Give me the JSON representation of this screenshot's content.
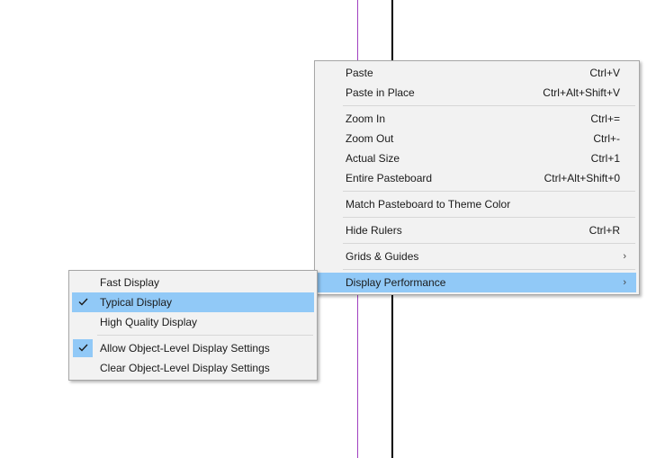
{
  "main_menu": {
    "items": [
      {
        "label": "Paste",
        "shortcut": "Ctrl+V"
      },
      {
        "label": "Paste in Place",
        "shortcut": "Ctrl+Alt+Shift+V"
      },
      {
        "label": "Zoom In",
        "shortcut": "Ctrl+="
      },
      {
        "label": "Zoom Out",
        "shortcut": "Ctrl+-"
      },
      {
        "label": "Actual Size",
        "shortcut": "Ctrl+1"
      },
      {
        "label": "Entire Pasteboard",
        "shortcut": "Ctrl+Alt+Shift+0"
      },
      {
        "label": "Match Pasteboard to Theme Color"
      },
      {
        "label": "Hide Rulers",
        "shortcut": "Ctrl+R"
      },
      {
        "label": "Grids & Guides",
        "arrow": "›"
      },
      {
        "label": "Display Performance",
        "arrow": "›",
        "highlighted": true
      }
    ]
  },
  "sub_menu": {
    "items": [
      {
        "label": "Fast Display",
        "checked": false
      },
      {
        "label": "Typical Display",
        "checked": true,
        "highlighted": true
      },
      {
        "label": "High Quality Display",
        "checked": false
      },
      {
        "label": "Allow Object-Level Display Settings",
        "checked": true
      },
      {
        "label": "Clear Object-Level Display Settings",
        "checked": false
      }
    ]
  },
  "colors": {
    "highlight": "#91c9f7",
    "menu_bg": "#f2f2f2",
    "guide_purple": "#a040c0",
    "guide_black": "#000000"
  }
}
